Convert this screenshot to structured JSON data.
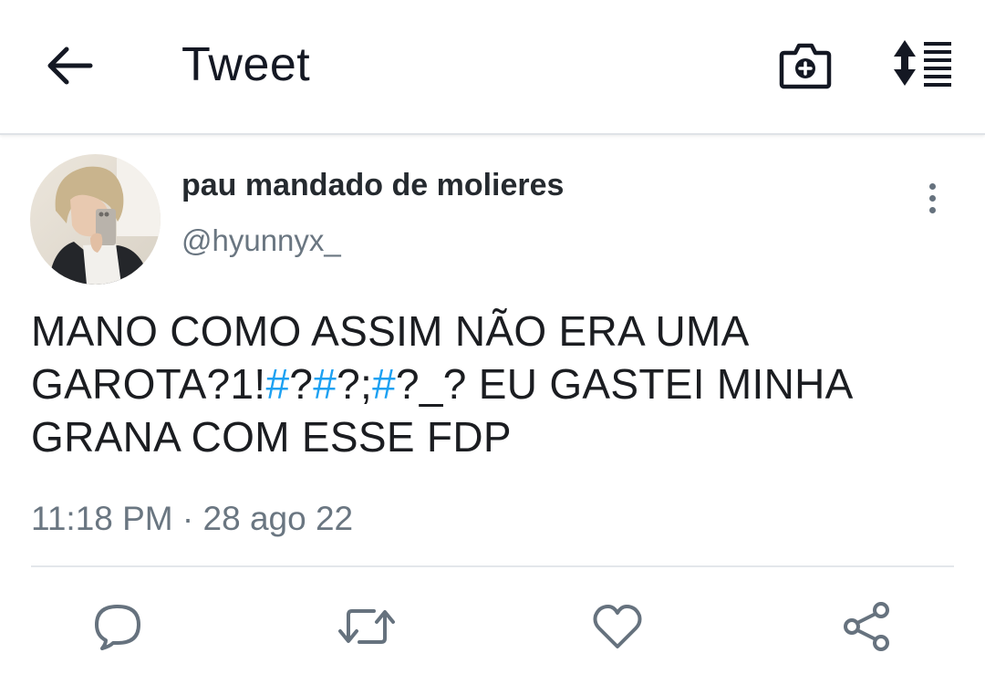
{
  "header": {
    "title": "Tweet",
    "icons": {
      "back": "arrow-left-icon",
      "camera": "camera-add-icon",
      "sort": "sort-list-icon"
    }
  },
  "tweet": {
    "author": {
      "display_name": "pau mandado de molieres",
      "handle": "@hyunnyx_"
    },
    "text_segments": [
      {
        "text": "MANO COMO ASSIM NÃO ERA UMA GAROTA?1!",
        "type": "text"
      },
      {
        "text": "#",
        "type": "hashtag"
      },
      {
        "text": "?",
        "type": "text"
      },
      {
        "text": "#",
        "type": "hashtag"
      },
      {
        "text": "?;",
        "type": "text"
      },
      {
        "text": "#",
        "type": "hashtag"
      },
      {
        "text": "?_? EU GASTEI MINHA GRANA COM ESSE FDP",
        "type": "text"
      }
    ],
    "timestamp": "11:18 PM · 28 ago 22"
  },
  "actions": [
    {
      "name": "reply",
      "icon": "reply-icon"
    },
    {
      "name": "retweet",
      "icon": "retweet-icon"
    },
    {
      "name": "like",
      "icon": "heart-icon"
    },
    {
      "name": "share",
      "icon": "share-icon"
    }
  ],
  "colors": {
    "hashtag": "#1da1f2",
    "secondary_text": "#6a7681",
    "primary_text": "#141823"
  }
}
